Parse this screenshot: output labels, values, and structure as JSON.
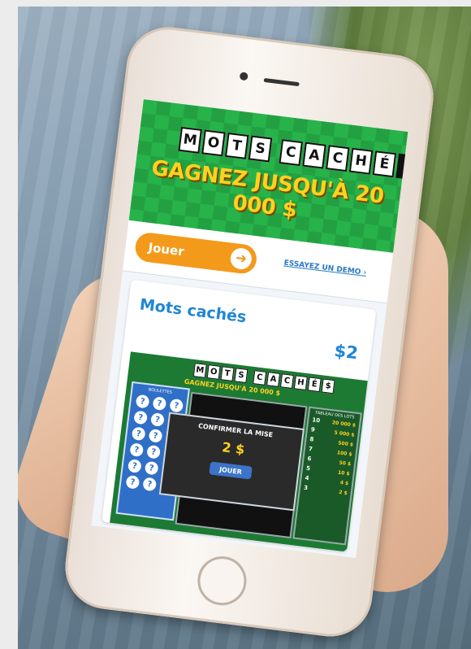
{
  "banner": {
    "logo_letters": [
      "M",
      "O",
      "T",
      "S",
      " ",
      "C",
      "A",
      "C",
      "H",
      "É",
      "$"
    ],
    "tagline": "GAGNEZ JUSQU'À 20 000 $"
  },
  "actions": {
    "play_label": "Jouer",
    "demo_label": "ESSAYEZ UN DEMO ›"
  },
  "card": {
    "title": "Mots cachés",
    "price": "$2"
  },
  "game": {
    "logo": "MOTS CACHÉ$",
    "tagline": "GAGNEZ JUSQU'À 20 000 $",
    "balls_title": "BOULETTES",
    "ball_symbol": "?",
    "dialog_title": "CONFIRMER LA MISE",
    "dialog_amount": "2 $",
    "dialog_button": "JOUER",
    "prizes_title": "TABLEAU DES LOTS",
    "prizes": [
      {
        "n": "10",
        "amt": "20 000 $"
      },
      {
        "n": "9",
        "amt": "5 000 $"
      },
      {
        "n": "8",
        "amt": "500 $"
      },
      {
        "n": "7",
        "amt": "100 $"
      },
      {
        "n": "6",
        "amt": "50 $"
      },
      {
        "n": "5",
        "amt": "10 $"
      },
      {
        "n": "4",
        "amt": "4 $"
      },
      {
        "n": "3",
        "amt": "2 $"
      }
    ]
  },
  "colors": {
    "banner_green": "#27b34a",
    "play_orange": "#f39a1a",
    "title_blue": "#1f86d6",
    "gold": "#ffd21f"
  }
}
